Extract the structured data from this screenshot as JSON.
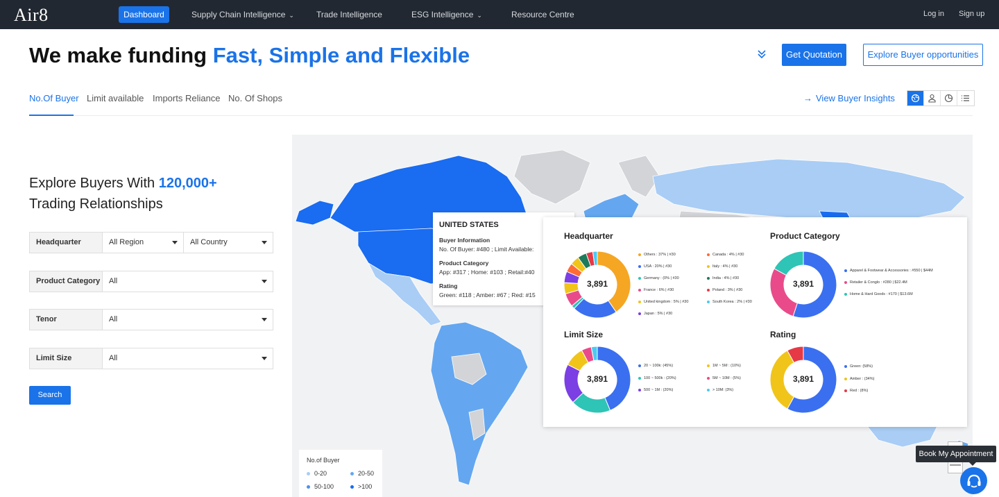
{
  "nav": {
    "logo": "Air8",
    "items": [
      {
        "label": "Dashboard",
        "active": true
      },
      {
        "label": "Supply Chain Intelligence",
        "has_dropdown": true
      },
      {
        "label": "Trade Intelligence",
        "has_dropdown": false
      },
      {
        "label": "ESG Intelligence",
        "has_dropdown": true
      },
      {
        "label": "Resource Centre",
        "has_dropdown": false
      }
    ],
    "login": "Log in",
    "signup": "Sign up"
  },
  "hero": {
    "title_plain": "We make funding ",
    "title_accent": "Fast, Simple and Flexible",
    "get_quotation": "Get Quotation",
    "explore_buyer": "Explore Buyer opportunities"
  },
  "tabs": [
    {
      "label": "No.Of Buyer",
      "active": true
    },
    {
      "label": "Limit available",
      "active": false
    },
    {
      "label": "Imports Reliance",
      "active": false
    },
    {
      "label": "No. Of Shops",
      "active": false
    }
  ],
  "view_insights": "View Buyer Insights",
  "view_modes": [
    "map-icon",
    "person-chart-icon",
    "clock-chart-icon",
    "list-icon"
  ],
  "left_panel": {
    "title_prefix": "Explore Buyers With ",
    "title_number": "120,000+",
    "title_line2": "Trading Relationships",
    "filters": [
      {
        "label": "Headquarter",
        "values": [
          "All Region",
          "All Country"
        ]
      },
      {
        "label": "Product Category",
        "values": [
          "All"
        ]
      },
      {
        "label": "Tenor",
        "values": [
          "All"
        ]
      },
      {
        "label": "Limit Size",
        "values": [
          "All"
        ]
      }
    ],
    "search_label": "Search"
  },
  "map_legend": {
    "title": "No.of Buyer",
    "items": [
      {
        "label": "0-20",
        "color": "#a9cdf5"
      },
      {
        "label": "20-50",
        "color": "#64a7f0"
      },
      {
        "label": "50-100",
        "color": "#4e8ef0"
      },
      {
        "label": ">100",
        "color": "#1a6cf0"
      }
    ]
  },
  "tooltip": {
    "country": "UNITED STATES",
    "buyer_info_label": "Buyer Information",
    "buyer_line": "No. Of Buyer: #480 ;  Limit Available:",
    "product_label": "Product Category",
    "product_line": "App: #317 ;  Home: #103 ;  Retail:#40",
    "rating_label": "Rating",
    "rating_line": "Green: #118 ; Amber: #67 ; Red: #15"
  },
  "panel": {
    "headquarter": {
      "title": "Headquarter",
      "total": "3,891",
      "legend": [
        {
          "label": "Others : 37% | #30",
          "color": "#f5a623"
        },
        {
          "label": "USA : 20% | #30",
          "color": "#3a6ff0"
        },
        {
          "label": "Germany : (0% | #30",
          "color": "#2ec4b6"
        },
        {
          "label": "France : 6% | #30",
          "color": "#e94b8a"
        },
        {
          "label": "United kingdom : 5% | #30",
          "color": "#f0c419"
        },
        {
          "label": "Japan : 5% | #30",
          "color": "#7b3fe4"
        },
        {
          "label": "Canada : 4% | #30",
          "color": "#ff6b35"
        },
        {
          "label": "Italy : 4% | #30",
          "color": "#f0c419"
        },
        {
          "label": "India : 4% | #30",
          "color": "#1d7a5a"
        },
        {
          "label": "Poland : 3% | #30",
          "color": "#e63946"
        },
        {
          "label": "South Korea : 2% | #30",
          "color": "#4cc9f0"
        }
      ]
    },
    "product_category": {
      "title": "Product Category",
      "total": "3,891",
      "legend": [
        {
          "label": "Apparel & Footwear & Accessories : #550  |  $44M",
          "color": "#3a6ff0"
        },
        {
          "label": "Retailer & Conglo : #280  |  $22.4M",
          "color": "#e94b8a"
        },
        {
          "label": "Home & Hard Goods : #170  |  $13.6M",
          "color": "#2ec4b6"
        }
      ]
    },
    "limit_size": {
      "title": "Limit Size",
      "total": "3,891",
      "legend": [
        {
          "label": "20 ~ 100k: (45%)",
          "color": "#3a6ff0"
        },
        {
          "label": "100 ~ 500k : (20%)",
          "color": "#2ec4b6"
        },
        {
          "label": "500 ~ 1M : (20%)",
          "color": "#7b3fe4"
        },
        {
          "label": "1M ~ 5M : (10%)",
          "color": "#f0c419"
        },
        {
          "label": "5M ~ 10M : (5%)",
          "color": "#e94b8a"
        },
        {
          "label": "> 10M: (3%)",
          "color": "#4cc9f0"
        }
      ]
    },
    "rating": {
      "title": "Rating",
      "total": "3,891",
      "legend": [
        {
          "label": "Green: (58%)",
          "color": "#3a6ff0"
        },
        {
          "label": "Amber : (34%)",
          "color": "#f0c419"
        },
        {
          "label": "Red : (8%)",
          "color": "#e63946"
        }
      ]
    }
  },
  "book_appointment": "Book My Appointment",
  "zoom_out_label": "—",
  "colors": {
    "accent": "#1a73e8",
    "nav_bg": "#222831"
  }
}
